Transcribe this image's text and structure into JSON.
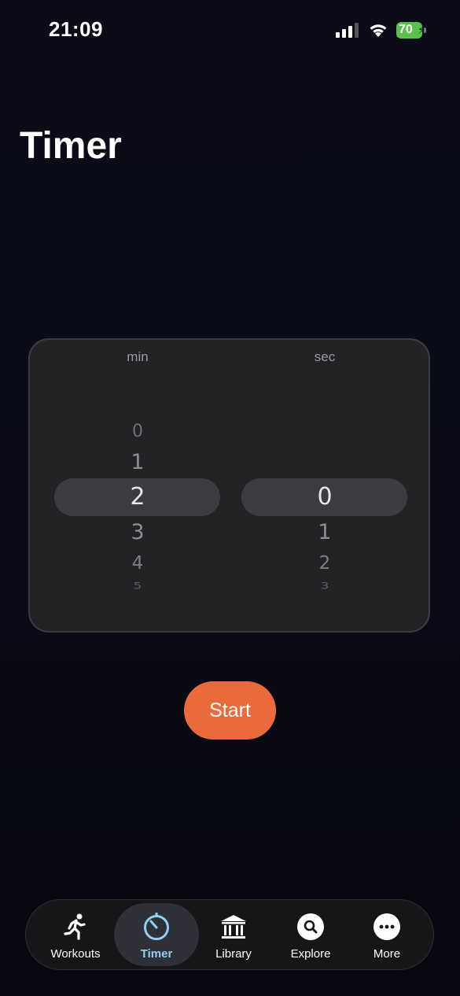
{
  "status_bar": {
    "time": "21:09",
    "battery": "70"
  },
  "page": {
    "title": "Timer"
  },
  "picker": {
    "min_label": "min",
    "sec_label": "sec",
    "minutes": [
      "0",
      "1",
      "2",
      "3",
      "4",
      "5"
    ],
    "seconds": [
      "0",
      "1",
      "2",
      "3"
    ],
    "selected_minute": "2",
    "selected_second": "0"
  },
  "actions": {
    "start_label": "Start"
  },
  "colors": {
    "accent": "#e96a3b",
    "active_tab": "#8ed0f5",
    "battery": "#5cc04e"
  },
  "tab_bar": {
    "active": "Timer",
    "items": [
      {
        "label": "Workouts",
        "icon": "runner-icon"
      },
      {
        "label": "Timer",
        "icon": "stopwatch-icon"
      },
      {
        "label": "Library",
        "icon": "library-icon"
      },
      {
        "label": "Explore",
        "icon": "search-icon"
      },
      {
        "label": "More",
        "icon": "more-icon"
      }
    ]
  }
}
